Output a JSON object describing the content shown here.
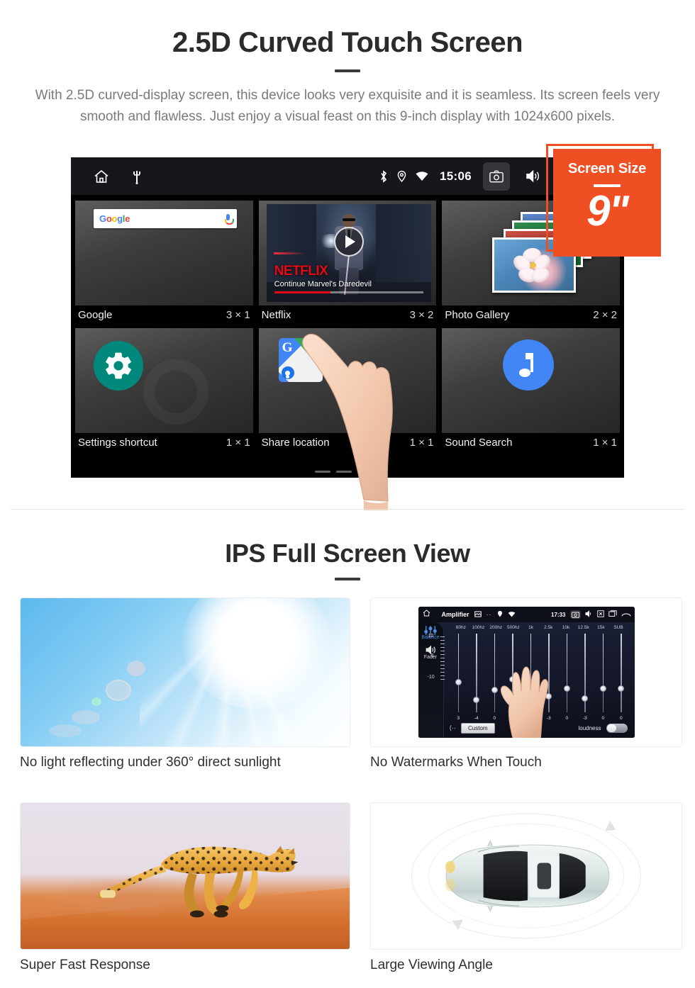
{
  "section1": {
    "title": "2.5D Curved Touch Screen",
    "description": "With 2.5D curved-display screen, this device looks very exquisite and it is seamless. Its screen feels very smooth and flawless. Just enjoy a visual feast on this 9-inch display with 1024x600 pixels.",
    "badge": {
      "label": "Screen Size",
      "value": "9\"",
      "color": "#F04E23"
    },
    "device_screen": {
      "statusbar": {
        "time": "15:06",
        "left_icons": [
          "home-icon",
          "usb-icon"
        ],
        "right_icons": [
          "bluetooth-icon",
          "location-icon",
          "wifi-icon"
        ],
        "buttons": [
          "camera-icon",
          "volume-icon",
          "close-icon",
          "recents-icon"
        ]
      },
      "widgets": [
        {
          "name": "Google",
          "size": "3 × 1",
          "icon": "google-search-widget",
          "search_value": "Google",
          "mic": "mic-icon"
        },
        {
          "name": "Netflix",
          "size": "3 × 2",
          "icon": "netflix-widget",
          "brand": "NETFLIX",
          "subtitle": "Continue Marvel's Daredevil"
        },
        {
          "name": "Photo Gallery",
          "size": "2 × 2",
          "icon": "photo-gallery-widget"
        },
        {
          "name": "Settings shortcut",
          "size": "1 × 1",
          "icon": "settings-gear-icon"
        },
        {
          "name": "Share location",
          "size": "1 × 1",
          "icon": "google-maps-icon"
        },
        {
          "name": "Sound Search",
          "size": "1 × 1",
          "icon": "music-note-icon"
        }
      ],
      "page_indicator": {
        "count": 3,
        "active_index": 2
      }
    }
  },
  "section2": {
    "title": "IPS Full Screen View",
    "cards": [
      {
        "caption": "No light reflecting under 360° direct sunlight",
        "media": "sunlight-photo"
      },
      {
        "caption": "No Watermarks When Touch",
        "media": "amplifier-screenshot"
      },
      {
        "caption": "Super Fast Response",
        "media": "cheetah-photo"
      },
      {
        "caption": "Large Viewing Angle",
        "media": "car-top-view-illustration"
      }
    ],
    "amplifier": {
      "title": "Amplifier",
      "time": "17:33",
      "sidebar": [
        "Balance",
        "Fader"
      ],
      "bands": [
        "60hz",
        "100hz",
        "200hz",
        "500hz",
        "1k",
        "2.5k",
        "10k",
        "12.5k",
        "15k",
        "SUB"
      ],
      "values": [
        "3",
        "-4",
        "0",
        "0",
        "0",
        "-3",
        "0",
        "-3",
        "0",
        "0"
      ],
      "scale": [
        "10",
        "0",
        "-10"
      ],
      "preset": "Custom",
      "loudness_label": "loudness",
      "back_label": "⟨··"
    }
  }
}
